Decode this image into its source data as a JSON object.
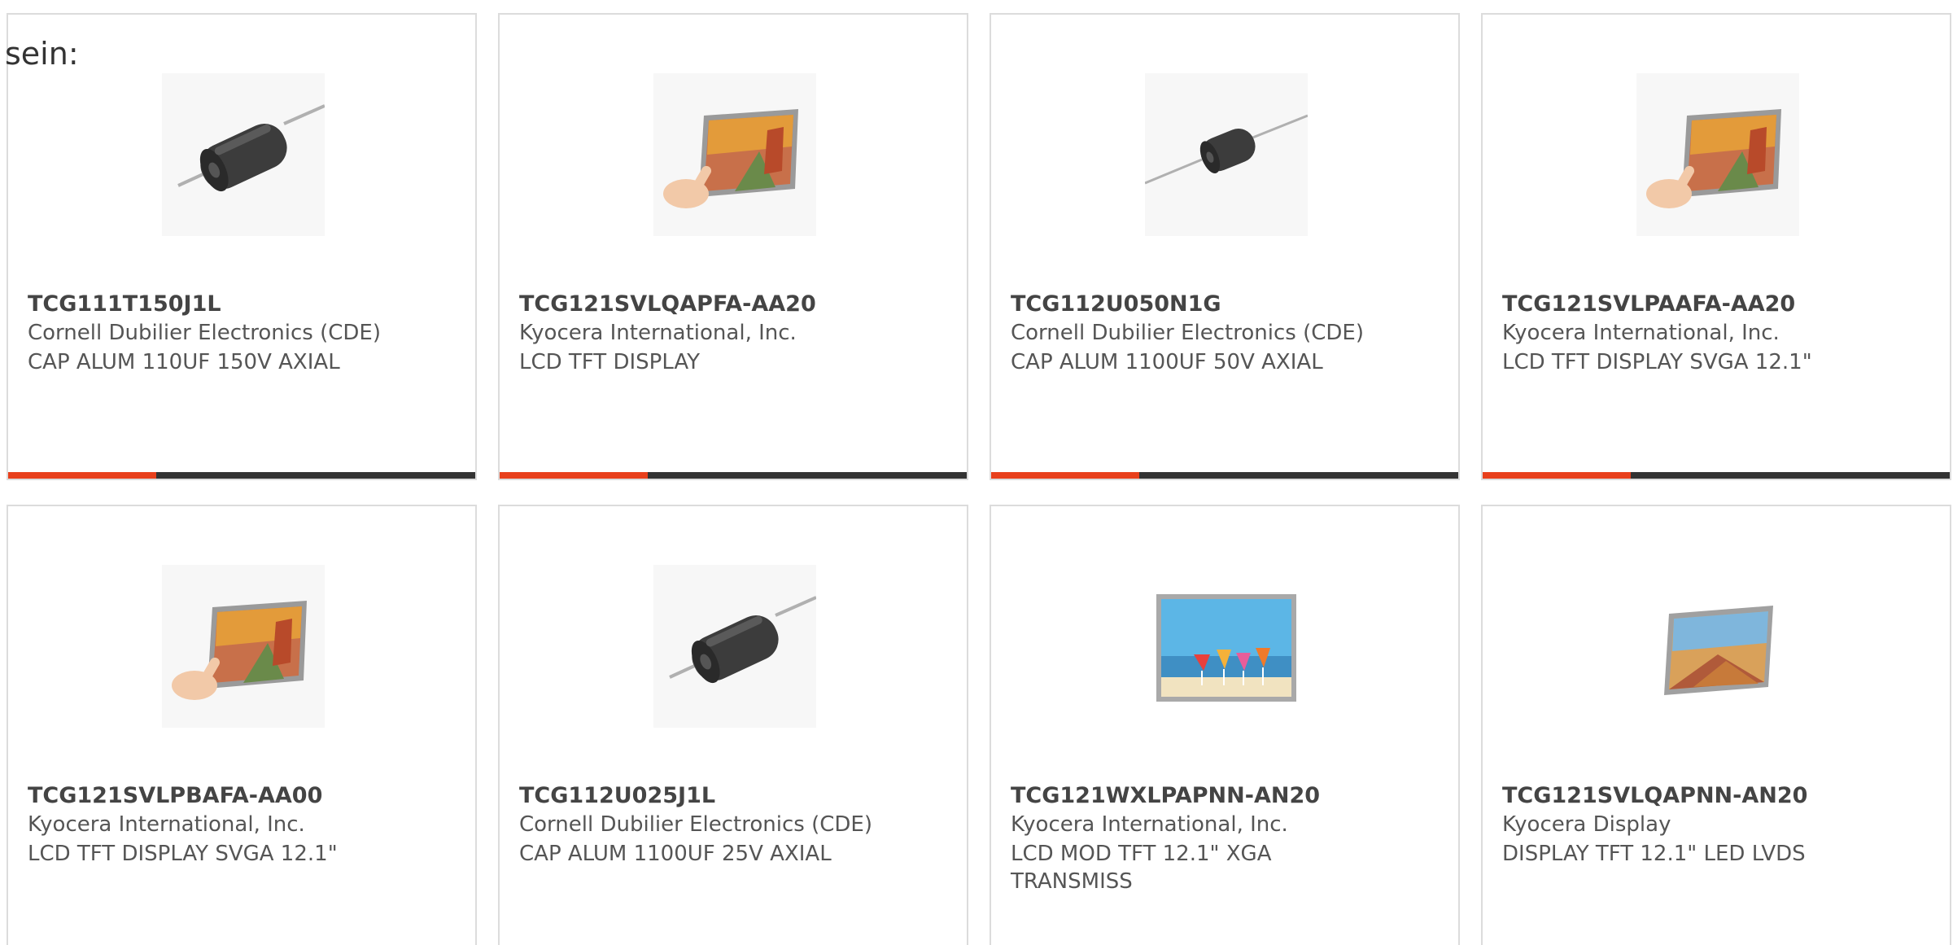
{
  "lead_text": "sein:",
  "accent_color": "#e8401c",
  "products": [
    {
      "part_number": "TCG111T150J1L",
      "manufacturer": "Cornell Dubilier Electronics (CDE)",
      "description": "CAP ALUM 110UF 150V AXIAL",
      "image": "axial-capacitor-icon",
      "has_bar": true
    },
    {
      "part_number": "TCG121SVLQAPFA-AA20",
      "manufacturer": "Kyocera International, Inc.",
      "description": "LCD TFT DISPLAY",
      "image": "touch-display-icon",
      "has_bar": true
    },
    {
      "part_number": "TCG112U050N1G",
      "manufacturer": "Cornell Dubilier Electronics (CDE)",
      "description": "CAP ALUM 1100UF 50V AXIAL",
      "image": "axial-capacitor-small-icon",
      "has_bar": true
    },
    {
      "part_number": "TCG121SVLPAAFA-AA20",
      "manufacturer": "Kyocera International, Inc.",
      "description": "LCD TFT DISPLAY SVGA 12.1\"",
      "image": "touch-display-icon",
      "has_bar": true
    },
    {
      "part_number": "TCG121SVLPBAFA-AA00",
      "manufacturer": "Kyocera International, Inc.",
      "description": "LCD TFT DISPLAY SVGA 12.1\"",
      "image": "touch-display-icon",
      "has_bar": false
    },
    {
      "part_number": "TCG112U025J1L",
      "manufacturer": "Cornell Dubilier Electronics (CDE)",
      "description": "CAP ALUM 1100UF 25V AXIAL",
      "image": "axial-capacitor-icon",
      "has_bar": false
    },
    {
      "part_number": "TCG121WXLPAPNN-AN20",
      "manufacturer": "Kyocera International, Inc.",
      "description": "LCD MOD TFT 12.1\" XGA TRANSMISS",
      "image": "beach-display-icon",
      "has_bar": false
    },
    {
      "part_number": "TCG121SVLQAPNN-AN20",
      "manufacturer": "Kyocera Display",
      "description": "DISPLAY TFT 12.1\" LED LVDS",
      "image": "tilted-display-icon",
      "has_bar": false
    }
  ]
}
